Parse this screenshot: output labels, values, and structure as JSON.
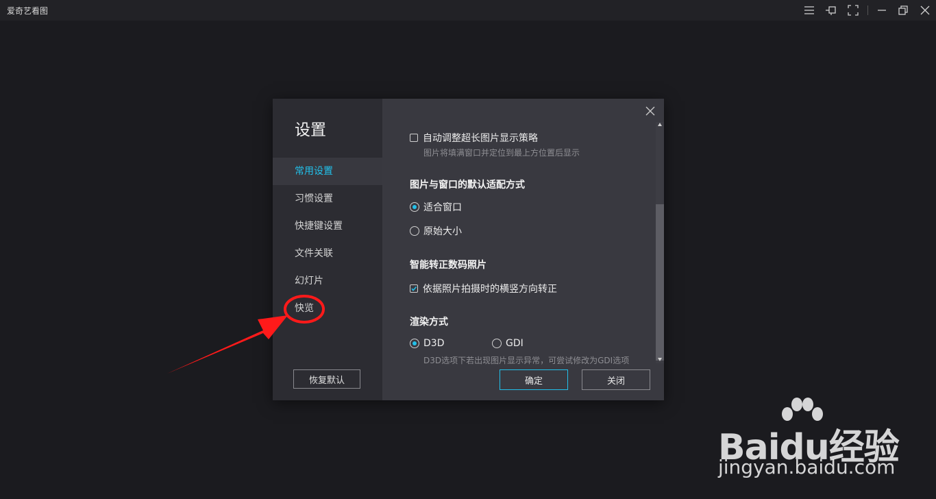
{
  "app": {
    "title": "爱奇艺看图"
  },
  "titlebar": {
    "icons": [
      "menu-icon",
      "pin-icon",
      "fullscreen-icon",
      "minimize-icon",
      "restore-icon",
      "close-icon"
    ]
  },
  "dialog": {
    "title": "设置",
    "nav": [
      {
        "label": "常用设置",
        "active": true
      },
      {
        "label": "习惯设置",
        "active": false
      },
      {
        "label": "快捷键设置",
        "active": false
      },
      {
        "label": "文件关联",
        "active": false
      },
      {
        "label": "幻灯片",
        "active": false
      },
      {
        "label": "快览",
        "active": false
      }
    ],
    "restore_label": "恢复默认",
    "options": {
      "auto_long": {
        "label": "自动调整超长图片显示策略",
        "hint": "图片将填满窗口并定位到最上方位置后显示",
        "checked": false
      },
      "fit_section": "图片与窗口的默认适配方式",
      "fit_window": {
        "label": "适合窗口",
        "checked": true
      },
      "original_size": {
        "label": "原始大小",
        "checked": false
      },
      "rotate_section": "智能转正数码照片",
      "rotate_option": {
        "label": "依据照片拍摄时的横竖方向转正",
        "checked": true
      },
      "render_section": "渲染方式",
      "d3d": {
        "label": "D3D",
        "checked": true
      },
      "gdi": {
        "label": "GDI",
        "checked": false
      },
      "render_hint": "D3D选项下若出现图片显示异常，可尝试修改为GDI选项"
    },
    "ok_label": "确定",
    "close_label": "关闭"
  },
  "accent_color": "#22c0ea",
  "annotation_color": "#ff1a1a",
  "watermark": {
    "brand": "Baidu经验",
    "url": "jingyan.baidu.com"
  }
}
